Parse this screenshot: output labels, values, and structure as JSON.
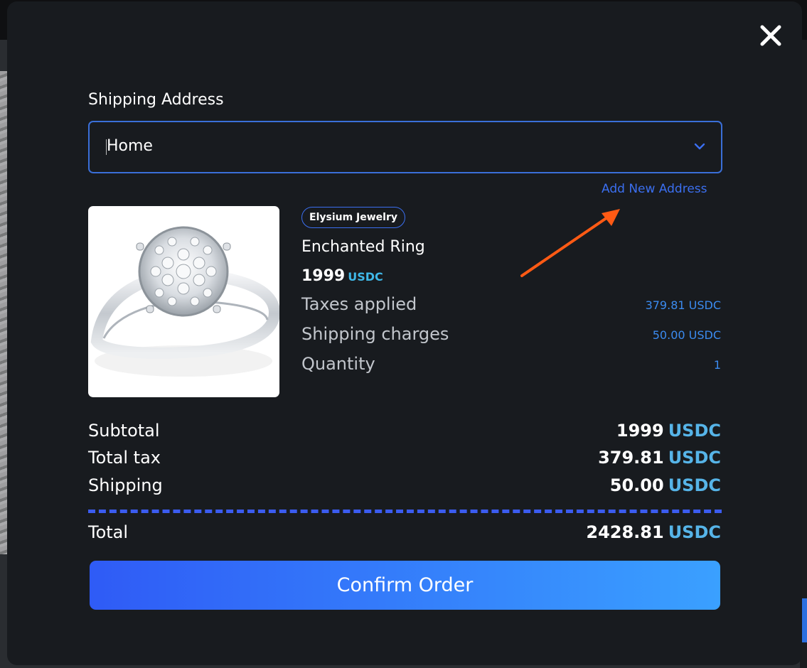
{
  "shipping": {
    "label": "Shipping Address",
    "selected": "Home",
    "add_new_label": "Add New Address"
  },
  "product": {
    "brand": "Elysium Jewelry",
    "name": "Enchanted Ring",
    "price": "1999",
    "currency": "USDC",
    "image_icon": "ring-image"
  },
  "details": {
    "taxes_label": "Taxes applied",
    "taxes_value": "379.81 USDC",
    "shipping_label": "Shipping charges",
    "shipping_value": "50.00 USDC",
    "quantity_label": "Quantity",
    "quantity_value": "1"
  },
  "summary": {
    "subtotal_label": "Subtotal",
    "subtotal_value": "1999",
    "tax_label": "Total tax",
    "tax_value": "379.81",
    "shipping_label": "Shipping",
    "shipping_value": "50.00",
    "total_label": "Total",
    "total_value": "2428.81",
    "currency": "USDC"
  },
  "actions": {
    "confirm_label": "Confirm Order",
    "close_icon": "close-icon"
  },
  "colors": {
    "modal_bg": "#181b1f",
    "accent": "#3b6ff0",
    "annotation_arrow": "#ff5a14",
    "button_gradient_start": "#2f5bf6",
    "button_gradient_end": "#3aa0ff"
  }
}
